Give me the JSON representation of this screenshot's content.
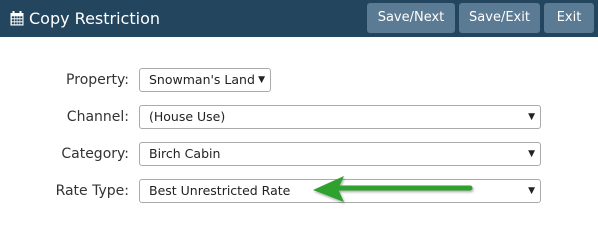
{
  "header": {
    "title": "Copy Restriction",
    "buttons": {
      "save_next": "Save/Next",
      "save_exit": "Save/Exit",
      "exit": "Exit"
    },
    "background_color": "#24455e",
    "button_color": "#5b7a93"
  },
  "form": {
    "property": {
      "label": "Property:",
      "value": "Snowman's Land"
    },
    "channel": {
      "label": "Channel:",
      "value": "(House Use)"
    },
    "category": {
      "label": "Category:",
      "value": "Birch Cabin"
    },
    "rate_type": {
      "label": "Rate Type:",
      "value": "Best Unrestricted Rate"
    }
  },
  "annotation": {
    "arrow_color": "#2ea12e",
    "icon": "calendar-icon"
  }
}
